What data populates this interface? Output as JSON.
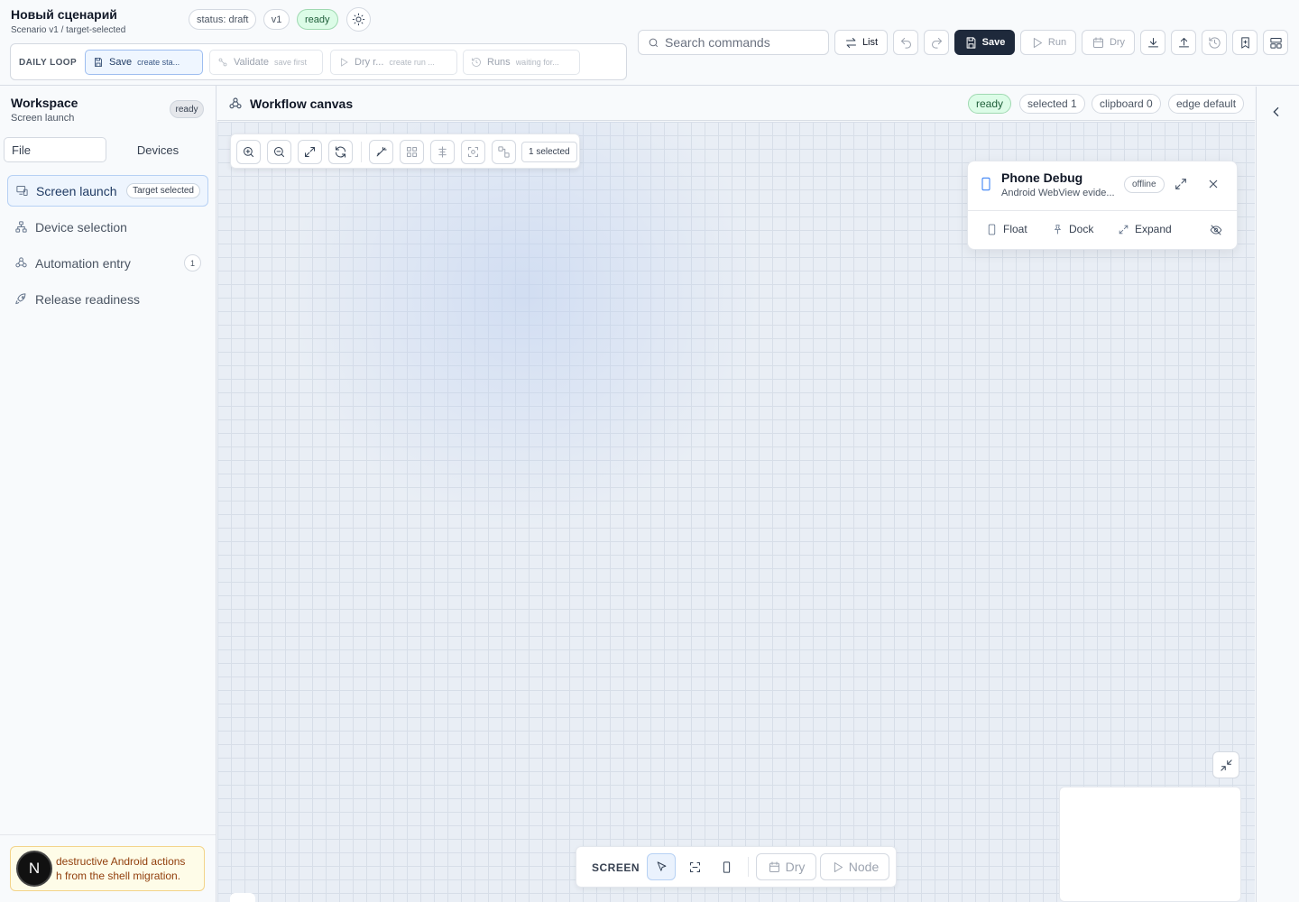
{
  "header": {
    "title": "Новый сценарий",
    "subtitle": "Scenario v1 / target-selected",
    "badges": {
      "status": "status: draft",
      "version": "v1",
      "state": "ready"
    },
    "daily_loop": {
      "label": "DAILY LOOP",
      "steps": [
        {
          "label": "Save",
          "sub": "create sta...",
          "active": true
        },
        {
          "label": "Validate",
          "sub": "save first",
          "active": false
        },
        {
          "label": "Dry r...",
          "sub": "create run ...",
          "active": false
        },
        {
          "label": "Runs",
          "sub": "waiting for...",
          "active": false
        }
      ]
    },
    "search": {
      "placeholder": "Search commands"
    },
    "toolbar": {
      "list_label": "List",
      "save_label": "Save",
      "run_label": "Run",
      "dry_label": "Dry"
    }
  },
  "sidebar": {
    "title": "Workspace",
    "subtitle": "Screen launch",
    "badge": "ready",
    "tabs": [
      "File",
      "Devices"
    ],
    "items": [
      {
        "label": "Screen launch",
        "badge": "Target selected",
        "icon": "screen-icon"
      },
      {
        "label": "Device selection",
        "icon": "device-tree-icon"
      },
      {
        "label": "Automation entry",
        "count": "1",
        "icon": "workflow-icon"
      },
      {
        "label": "Release readiness",
        "icon": "rocket-icon"
      }
    ],
    "warning": "destructive Android actions\nh from the shell migration.",
    "avatar": "N"
  },
  "canvas": {
    "title": "Workflow canvas",
    "status_pills": [
      "ready",
      "selected 1",
      "clipboard 0",
      "edge default"
    ],
    "zoombar": {
      "selected": "1 selected"
    },
    "phone_debug": {
      "title": "Phone Debug",
      "subtitle": "Android WebView evide...",
      "status": "offline",
      "actions": [
        "Float",
        "Dock",
        "Expand"
      ]
    },
    "bottombar": {
      "label": "SCREEN",
      "dry": "Dry",
      "node": "Node"
    }
  },
  "colors": {
    "accent": "#1e293b",
    "ready_green": "#dcfce7",
    "active_blue": "#eef5fe",
    "warning_bg": "#fefce8"
  }
}
